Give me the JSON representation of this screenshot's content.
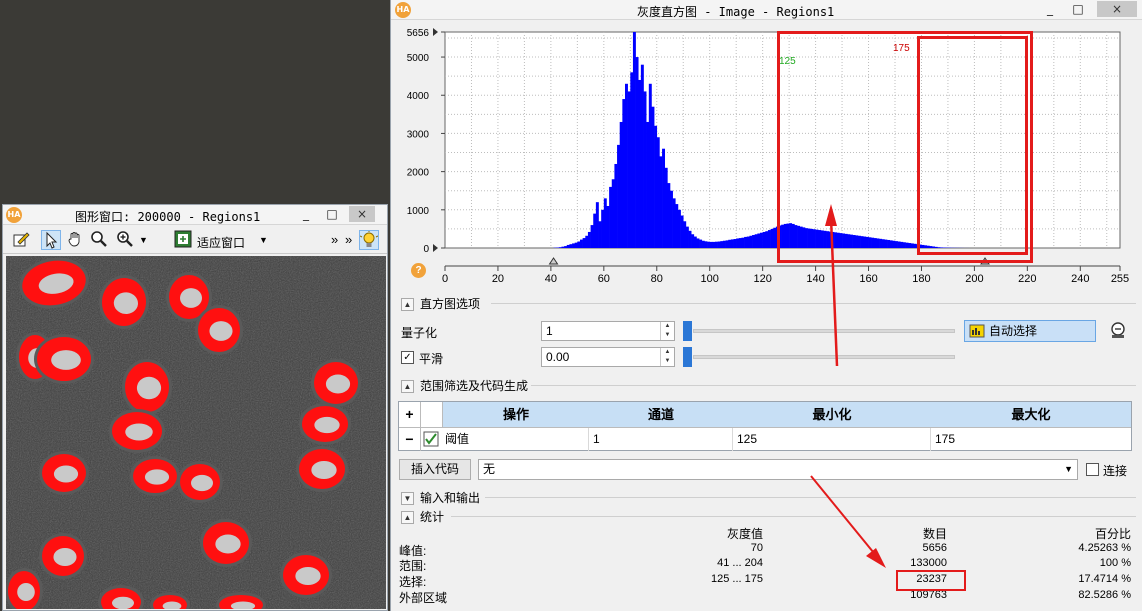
{
  "graphics_window": {
    "title": "图形窗口: 200000 - Regions1",
    "logo": "HA",
    "toolbar": {
      "fit_label": "适应窗口",
      "more_label": "»",
      "icons": [
        "edit-icon",
        "pointer-icon",
        "hand-icon",
        "magnifier-icon",
        "zoom-in-icon",
        "fit-window-icon",
        "bulb-icon"
      ]
    },
    "win_buttons": [
      "_",
      "□",
      "×"
    ]
  },
  "histogram_window": {
    "title": "灰度直方图 - Image - Regions1",
    "logo": "HA",
    "win_buttons": [
      "_",
      "□",
      "×"
    ],
    "threshold_min_label": "125",
    "threshold_max_label": "175",
    "help_icon": "?"
  },
  "chart_data": {
    "type": "bar",
    "title": "",
    "xlabel": "",
    "ylabel": "",
    "xlim": [
      0,
      255
    ],
    "ylim": [
      0,
      5656
    ],
    "x_ticks": [
      0,
      20,
      40,
      60,
      80,
      100,
      120,
      140,
      160,
      180,
      200,
      220,
      240,
      255
    ],
    "y_ticks": [
      0,
      1000,
      2000,
      3000,
      4000,
      5000,
      5656
    ],
    "grid": true,
    "bar_color": "#0000ff",
    "x_start": 41,
    "values": [
      8,
      12,
      20,
      35,
      50,
      80,
      100,
      120,
      140,
      170,
      220,
      260,
      320,
      420,
      600,
      900,
      1200,
      700,
      1000,
      1300,
      1100,
      1600,
      1800,
      2200,
      2700,
      3300,
      3900,
      4300,
      4100,
      4600,
      5656,
      5000,
      4400,
      4800,
      4100,
      3300,
      4300,
      3700,
      3200,
      2900,
      2400,
      2600,
      2100,
      1700,
      1500,
      1300,
      1150,
      1000,
      850,
      700,
      560,
      450,
      360,
      300,
      250,
      220,
      190,
      175,
      165,
      160,
      160,
      165,
      170,
      180,
      190,
      200,
      215,
      225,
      235,
      250,
      260,
      270,
      290,
      300,
      320,
      340,
      360,
      380,
      400,
      420,
      440,
      470,
      500,
      530,
      560,
      590,
      610,
      630,
      640,
      650,
      630,
      600,
      580,
      560,
      540,
      520,
      510,
      500,
      490,
      480,
      470,
      460,
      450,
      440,
      430,
      420,
      410,
      400,
      390,
      380,
      370,
      360,
      350,
      340,
      330,
      320,
      310,
      300,
      290,
      280,
      270,
      260,
      250,
      240,
      230,
      220,
      210,
      200,
      190,
      180,
      170,
      160,
      150,
      140,
      130,
      120,
      110,
      100,
      90,
      80,
      70,
      60,
      50,
      40,
      30,
      20,
      15,
      12,
      10,
      8,
      6,
      5,
      4,
      3,
      2,
      1,
      1,
      0,
      0,
      0
    ]
  },
  "histogram_options": {
    "section_label": "直方图选项",
    "quantize_label": "量子化",
    "quantize_value": "1",
    "smooth_label": "平滑",
    "smooth_value": "0.00",
    "auto_select_label": "自动选择"
  },
  "range_filter": {
    "section_label": "范围筛选及代码生成",
    "columns": [
      "操作",
      "通道",
      "最小化",
      "最大化"
    ],
    "add_button": "+",
    "remove_button": "−",
    "row": {
      "op": "阈值",
      "channel": "1",
      "min": "125",
      "max": "175"
    },
    "insert_code_label": "插入代码",
    "combo_value": "无",
    "connect_label": "连接"
  },
  "io_section": {
    "label": "输入和输出"
  },
  "statistics": {
    "section_label": "统计",
    "headers": {
      "gray": "灰度值",
      "count": "数目",
      "percent": "百分比"
    },
    "rows": [
      {
        "label": "峰值:",
        "gray": "70",
        "count": "5656",
        "percent": "4.25263 %"
      },
      {
        "label": "范围:",
        "gray": "41 ... 204",
        "count": "133000",
        "percent": "100 %"
      },
      {
        "label": "选择:",
        "gray": "125 ... 175",
        "count": "23237",
        "percent": "17.4714 %"
      },
      {
        "label": "外部区域",
        "gray": "",
        "count": "109763",
        "percent": "82.5286 %"
      }
    ]
  }
}
